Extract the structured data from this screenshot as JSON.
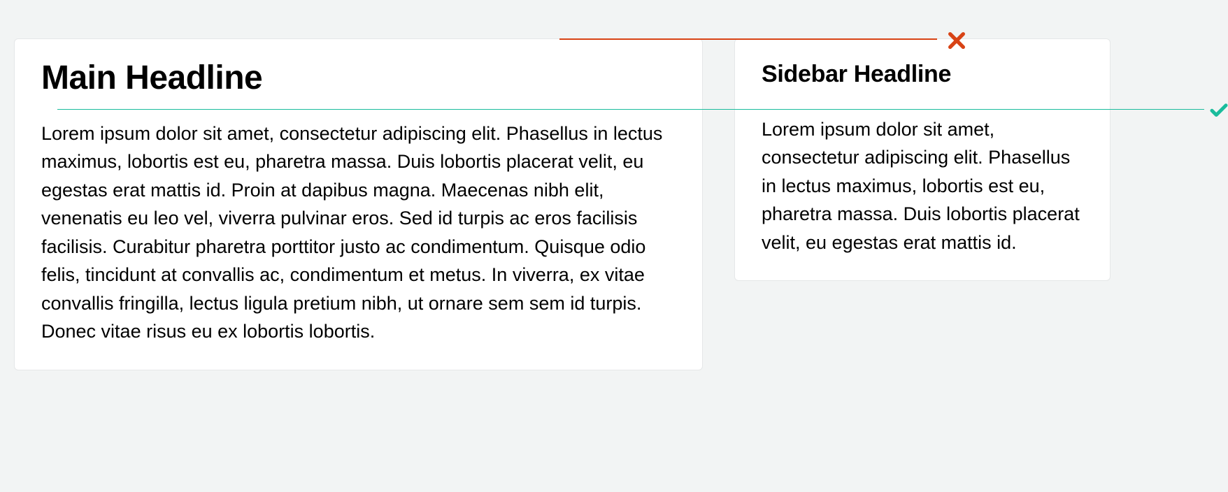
{
  "main": {
    "headline": "Main Headline",
    "body": "Lorem ipsum dolor sit amet, consectetur adipiscing elit. Phasellus in lectus maximus, lobortis est eu, pharetra massa. Duis lobortis placerat velit, eu egestas erat mattis id. Proin at dapibus magna. Maecenas nibh elit, venenatis eu leo vel, viverra pulvinar eros. Sed id turpis ac eros facilisis facilisis. Curabitur pharetra porttitor justo ac condimentum. Quisque odio felis, tincidunt at convallis ac, condimentum et metus. In viverra, ex vitae convallis fringilla, lectus ligula pretium nibh, ut ornare sem sem id turpis. Donec vitae risus eu ex lobortis lobortis."
  },
  "sidebar": {
    "headline": "Sidebar Headline",
    "body": "Lorem ipsum dolor sit amet, consectetur adipiscing elit. Phasellus in lectus maximus, lobortis est eu, pharetra massa. Duis lobortis placerat velit, eu egestas erat mattis id."
  },
  "annotations": {
    "wrong_color": "#d84315",
    "correct_color": "#1abc9c"
  }
}
